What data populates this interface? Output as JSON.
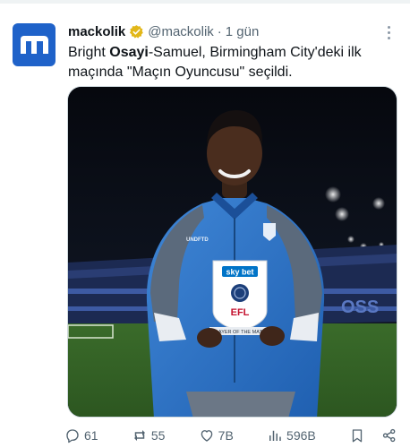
{
  "author": {
    "display_name": "mackolik",
    "handle": "@mackolik",
    "separator": "·",
    "time": "1 gün"
  },
  "tweet": {
    "text_part1": "Bright ",
    "text_bold": "Osayi",
    "text_part2": "-Samuel, Birmingham City'deki ilk maçında \"Maçın Oyuncusu\" seçildi."
  },
  "media": {
    "sponsor_badge": "sky bet",
    "league_badge": "EFL",
    "trophy_text": "PLAYER OF THE MATCH",
    "stadium_text": "OSS",
    "kit_brand": "UNDFTD"
  },
  "actions": {
    "replies": "61",
    "reposts": "55",
    "likes": "7B",
    "views": "596B"
  },
  "colors": {
    "brand_blue": "#1f62c9",
    "verified_gold": "#e2b719",
    "secondary_text": "#536471"
  }
}
